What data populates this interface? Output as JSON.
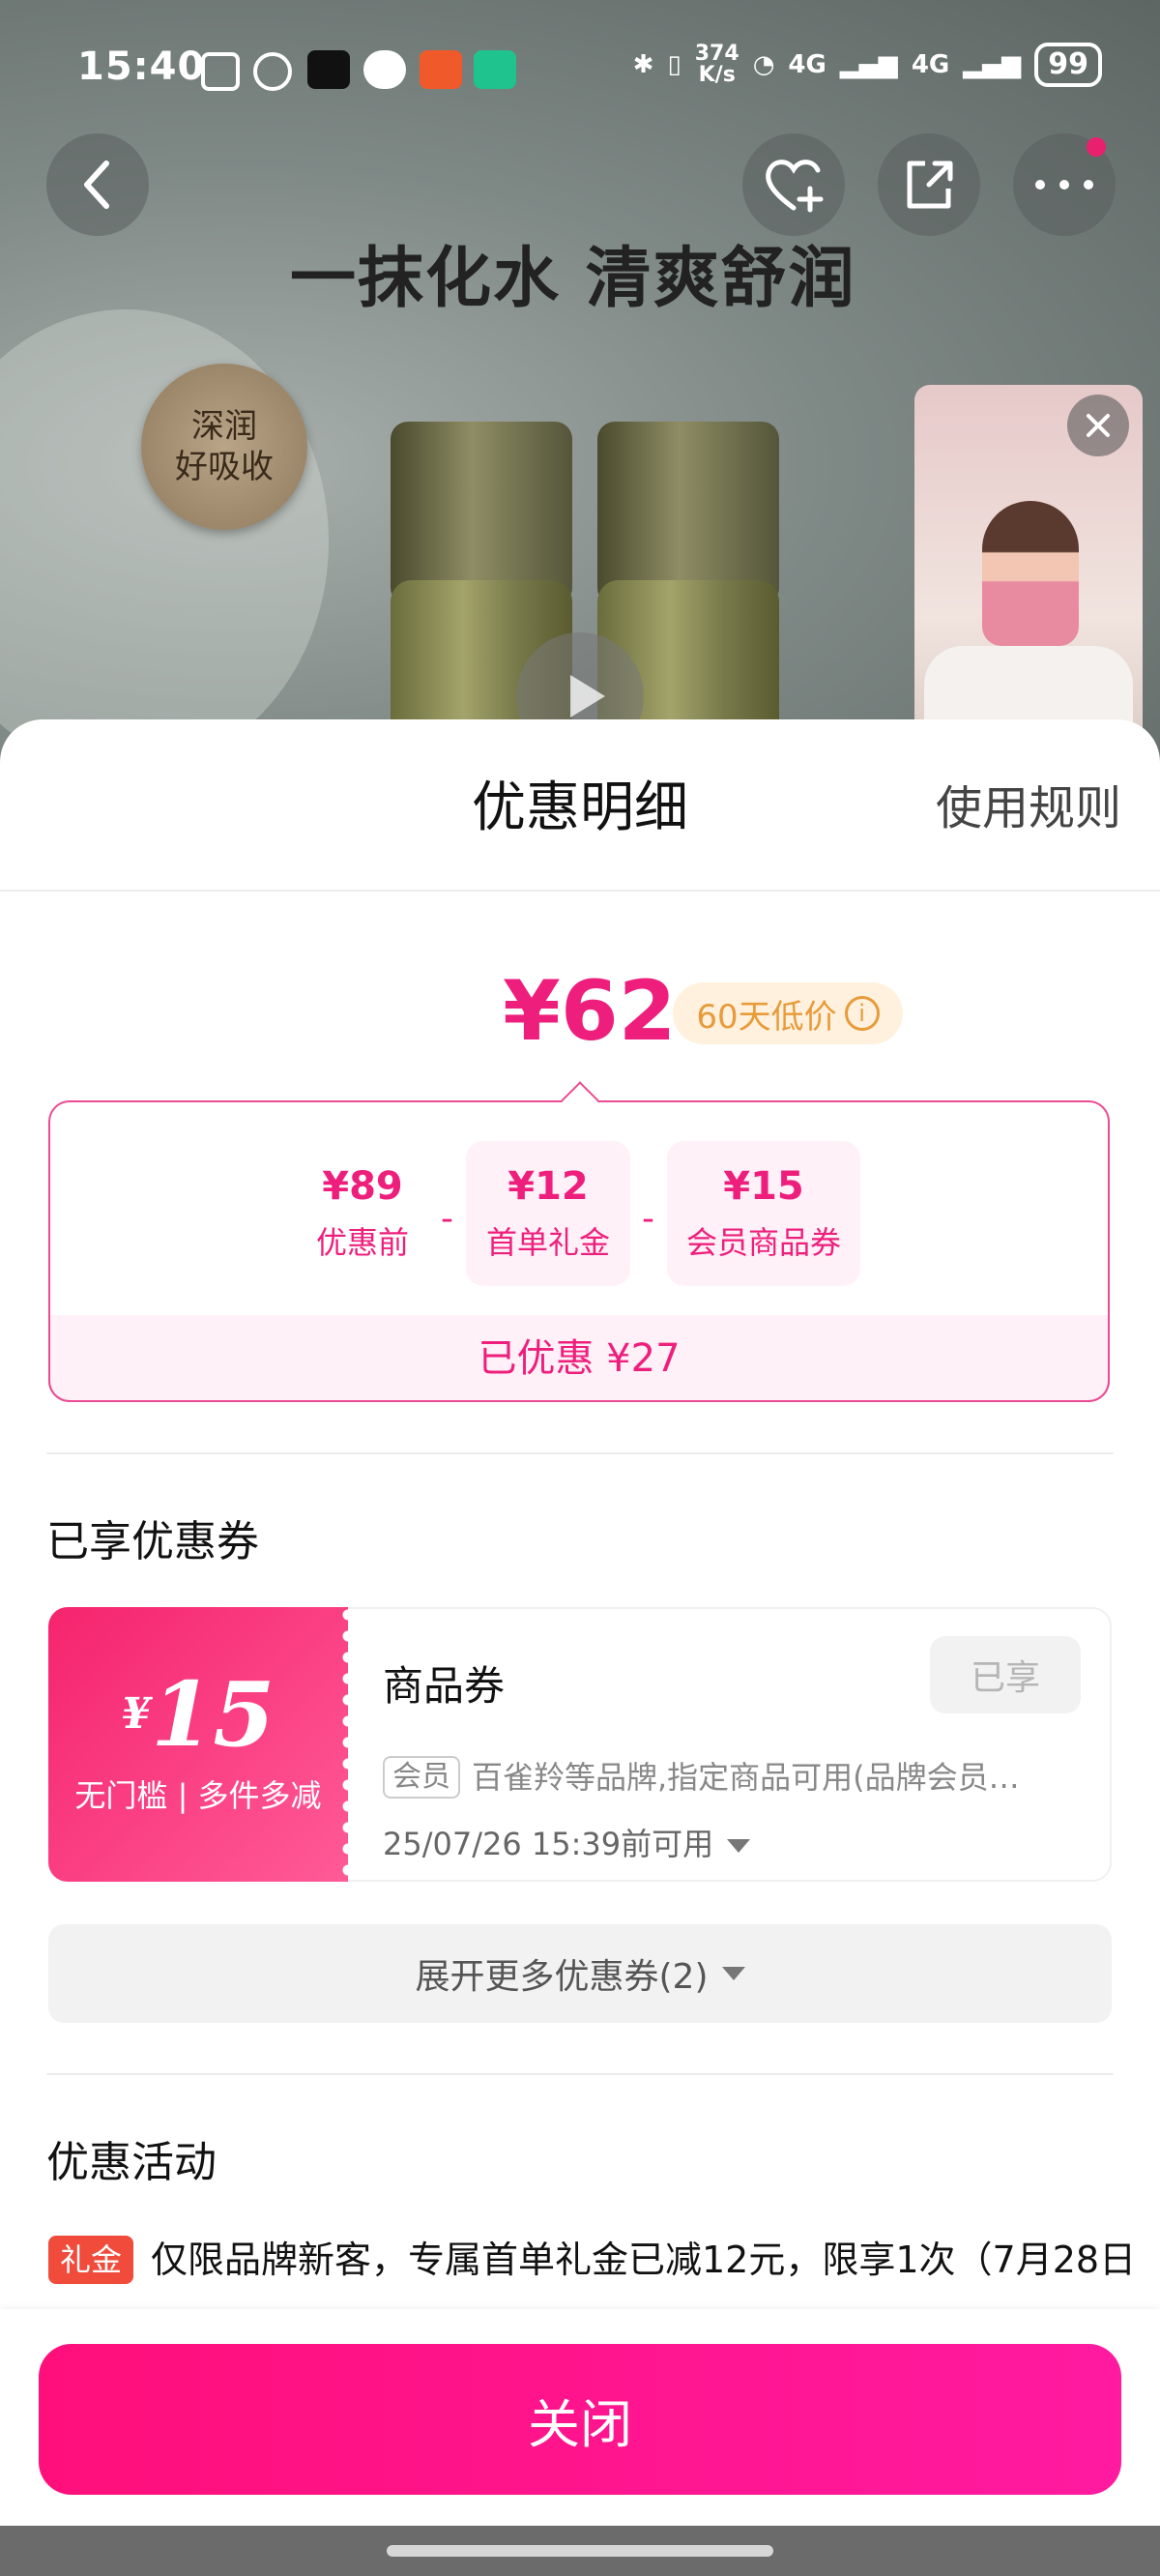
{
  "status_bar": {
    "time": "15:40",
    "net_speed": "374\nK/s",
    "signal_1": "4G",
    "signal_2": "4G",
    "battery": "99"
  },
  "banner": {
    "title": "一抹化水 清爽舒润",
    "badge_line1": "深润",
    "badge_line2": "好吸收"
  },
  "sheet": {
    "title": "优惠明细",
    "rules_link": "使用规则",
    "final_price": "¥62",
    "low_price_tag": "60天低价",
    "breakdown": [
      {
        "value": "¥89",
        "label": "优惠前"
      },
      {
        "value": "¥12",
        "label": "首单礼金"
      },
      {
        "value": "¥15",
        "label": "会员商品券"
      }
    ],
    "operator": "-",
    "saved": "已优惠 ¥27"
  },
  "coupons_section": {
    "title": "已享优惠券",
    "coupon": {
      "currency": "¥",
      "amount": "15",
      "condition": "无门槛 | 多件多减",
      "name": "商品券",
      "status": "已享",
      "member_tag": "会员",
      "description": "百雀羚等品牌,指定商品可用(品牌会员…",
      "valid_until": "25/07/26 15:39前可用"
    },
    "expand_label": "展开更多优惠券(2)"
  },
  "activities_section": {
    "title": "优惠活动",
    "items": [
      {
        "tag": "礼金",
        "text": "仅限品牌新客，专属首单礼金已减12元，限享1次（7月28日"
      }
    ]
  },
  "footer": {
    "close_label": "关闭"
  },
  "colors": {
    "accent": "#ee1f7c",
    "button": "#ff0f7a",
    "tag_red": "#f04b3b"
  }
}
